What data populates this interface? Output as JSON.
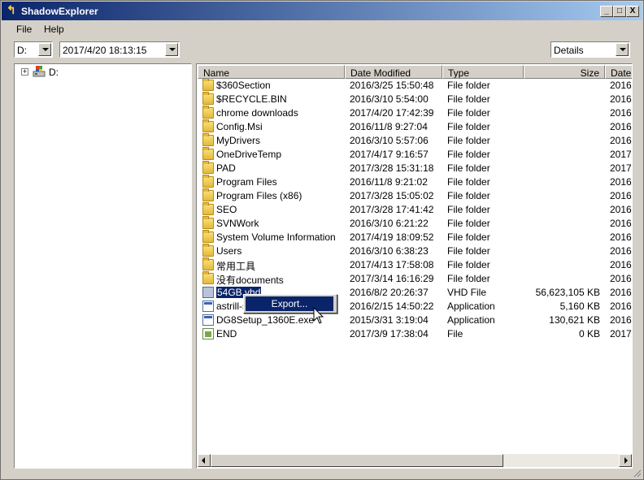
{
  "window": {
    "title": "ShadowExplorer",
    "buttons": [
      "_",
      "□",
      "X"
    ]
  },
  "menu": [
    "File",
    "Help"
  ],
  "toolbar": {
    "drive_value": "D:",
    "snapshot_value": "2017/4/20 18:13:15",
    "view_value": "Details"
  },
  "tree": {
    "root_label": "D:",
    "expander": "+"
  },
  "list": {
    "columns": [
      "Name",
      "Date Modified",
      "Type",
      "Size",
      "Date"
    ],
    "rows": [
      {
        "icon": "folder-icon",
        "name": "$360Section",
        "date": "2016/3/25 15:50:48",
        "type": "File folder",
        "size": "",
        "date2": "2016/"
      },
      {
        "icon": "folder-icon",
        "name": "$RECYCLE.BIN",
        "date": "2016/3/10 5:54:00",
        "type": "File folder",
        "size": "",
        "date2": "2016/"
      },
      {
        "icon": "folder-icon",
        "name": "chrome downloads",
        "date": "2017/4/20 17:42:39",
        "type": "File folder",
        "size": "",
        "date2": "2016/"
      },
      {
        "icon": "folder-icon",
        "name": "Config.Msi",
        "date": "2016/11/8 9:27:04",
        "type": "File folder",
        "size": "",
        "date2": "2016/"
      },
      {
        "icon": "folder-icon",
        "name": "MyDrivers",
        "date": "2016/3/10 5:57:06",
        "type": "File folder",
        "size": "",
        "date2": "2016/"
      },
      {
        "icon": "folder-icon",
        "name": "OneDriveTemp",
        "date": "2017/4/17 9:16:57",
        "type": "File folder",
        "size": "",
        "date2": "2017/"
      },
      {
        "icon": "folder-icon",
        "name": "PAD",
        "date": "2017/3/28 15:31:18",
        "type": "File folder",
        "size": "",
        "date2": "2017/"
      },
      {
        "icon": "folder-icon",
        "name": "Program Files",
        "date": "2016/11/8 9:21:02",
        "type": "File folder",
        "size": "",
        "date2": "2016/"
      },
      {
        "icon": "folder-icon",
        "name": "Program Files (x86)",
        "date": "2017/3/28 15:05:02",
        "type": "File folder",
        "size": "",
        "date2": "2016/"
      },
      {
        "icon": "folder-icon",
        "name": "SEO",
        "date": "2017/3/28 17:41:42",
        "type": "File folder",
        "size": "",
        "date2": "2016/"
      },
      {
        "icon": "folder-icon",
        "name": "SVNWork",
        "date": "2016/3/10 6:21:22",
        "type": "File folder",
        "size": "",
        "date2": "2016/"
      },
      {
        "icon": "folder-icon",
        "name": "System Volume Information",
        "date": "2017/4/19 18:09:52",
        "type": "File folder",
        "size": "",
        "date2": "2016/"
      },
      {
        "icon": "folder-icon",
        "name": "Users",
        "date": "2016/3/10 6:38:23",
        "type": "File folder",
        "size": "",
        "date2": "2016/"
      },
      {
        "icon": "folder-icon",
        "name": "常用工具",
        "date": "2017/4/13 17:58:08",
        "type": "File folder",
        "size": "",
        "date2": "2016/"
      },
      {
        "icon": "folder-icon",
        "name": "没有documents",
        "date": "2017/3/14 16:16:29",
        "type": "File folder",
        "size": "",
        "date2": "2016/"
      },
      {
        "icon": "vhd-icon",
        "name": "54GB.vhd",
        "date": "2016/8/2 20:26:37",
        "type": "VHD File",
        "size": "56,623,105 KB",
        "date2": "2016/",
        "selected": true
      },
      {
        "icon": "app-icon",
        "name": "astrill-se",
        "date": "2016/2/15 14:50:22",
        "type": "Application",
        "size": "5,160 KB",
        "date2": "2016/"
      },
      {
        "icon": "app-icon",
        "name": "DG8Setup_1360E.exe",
        "date": "2015/3/31 3:19:04",
        "type": "Application",
        "size": "130,621 KB",
        "date2": "2016/"
      },
      {
        "icon": "file-icon",
        "name": "END",
        "date": "2017/3/9 17:38:04",
        "type": "File",
        "size": "0 KB",
        "date2": "2017/"
      }
    ]
  },
  "context_menu": {
    "export_label": "Export..."
  }
}
